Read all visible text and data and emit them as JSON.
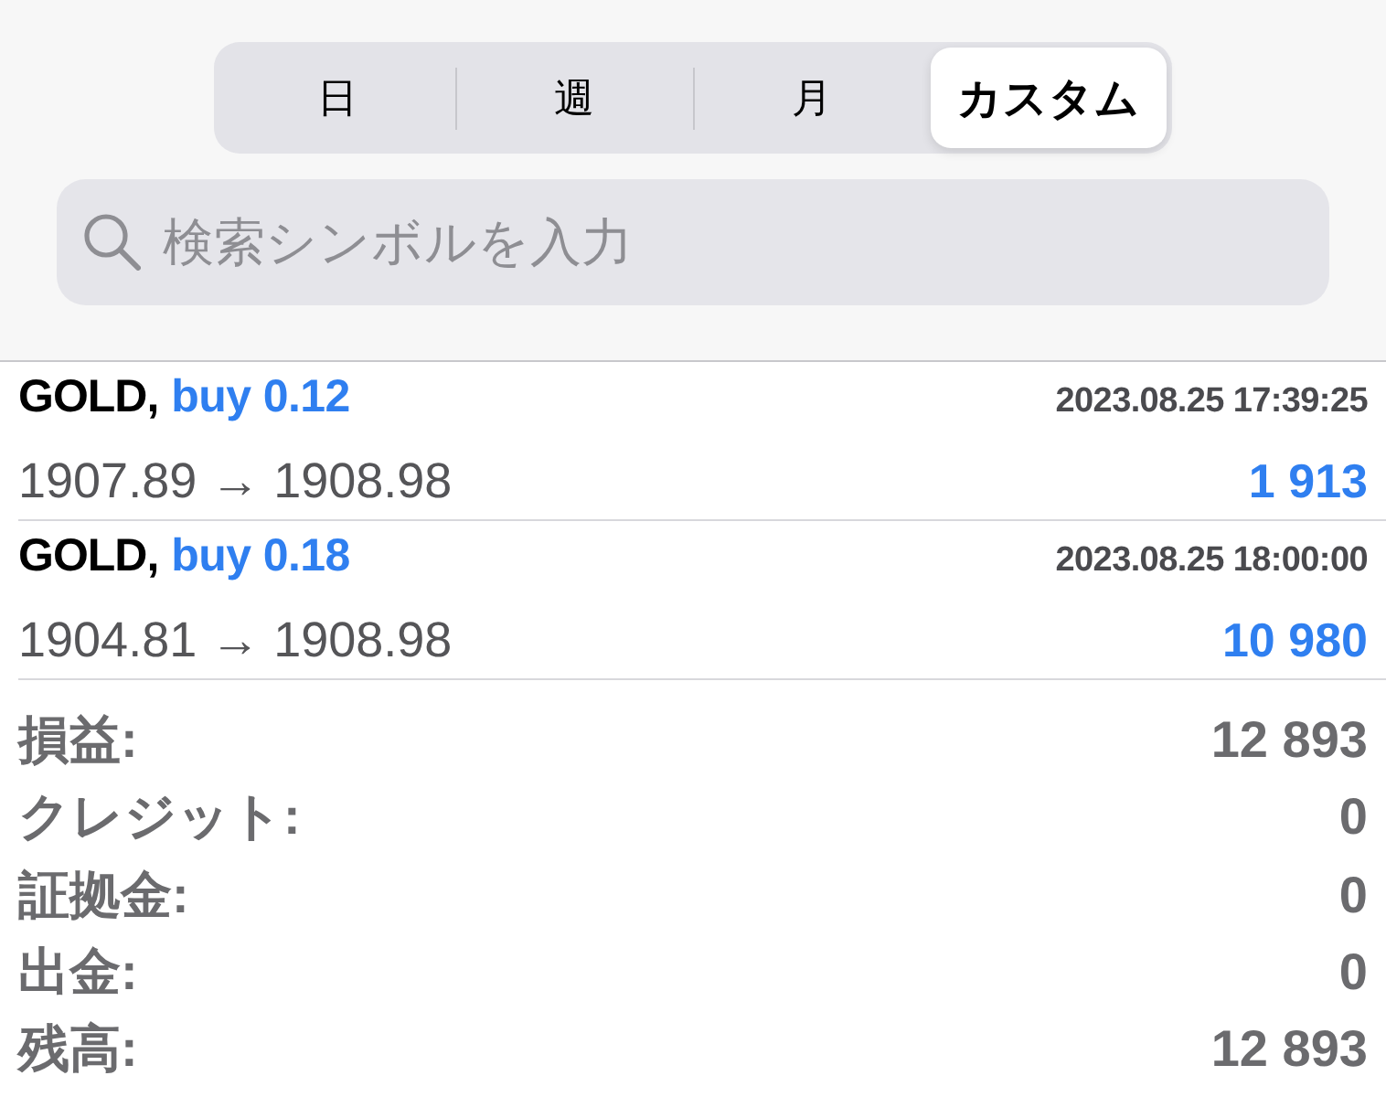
{
  "tabs": [
    {
      "label": "日",
      "selected": false
    },
    {
      "label": "週",
      "selected": false
    },
    {
      "label": "月",
      "selected": false
    },
    {
      "label": "カスタム",
      "selected": true
    }
  ],
  "search": {
    "placeholder": "検索シンボルを入力"
  },
  "trades": [
    {
      "symbol": "GOLD,",
      "deal": "buy 0.12",
      "time": "2023.08.25 17:39:25",
      "prices": "1907.89 → 1908.98",
      "profit": "1 913"
    },
    {
      "symbol": "GOLD,",
      "deal": "buy 0.18",
      "time": "2023.08.25 18:00:00",
      "prices": "1904.81 → 1908.98",
      "profit": "10 980"
    }
  ],
  "summary": [
    {
      "label": "損益:",
      "value": "12 893"
    },
    {
      "label": "クレジット:",
      "value": "0"
    },
    {
      "label": "証拠金:",
      "value": "0"
    },
    {
      "label": "出金:",
      "value": "0"
    },
    {
      "label": "残高:",
      "value": "12 893"
    }
  ]
}
